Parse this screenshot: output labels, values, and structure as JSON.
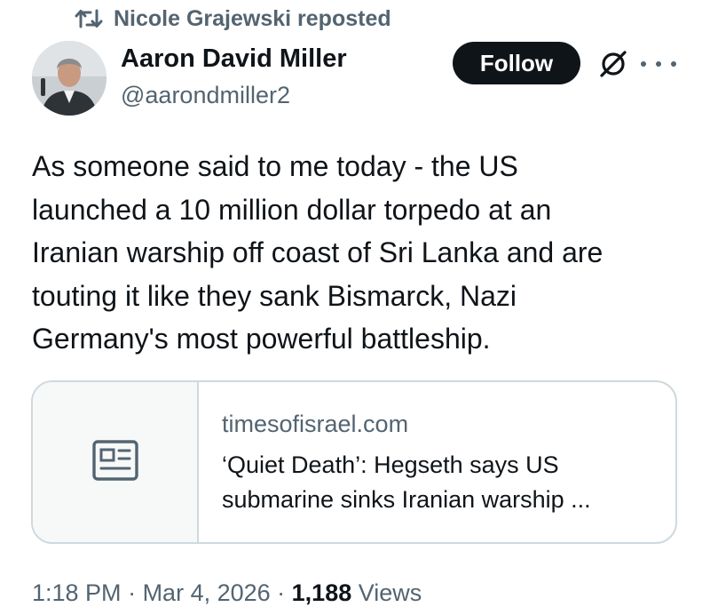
{
  "repost": {
    "icon": "repost-icon",
    "text": "Nicole Grajewski reposted"
  },
  "author": {
    "name": "Aaron David Miller",
    "handle": "@aarondmiller2",
    "avatar_icon": "avatar-photo"
  },
  "actions": {
    "follow_label": "Follow",
    "grok_icon": "grok-icon",
    "more_icon": "more-icon"
  },
  "tweet": {
    "text": "As someone said to me today - the US\nlaunched a 10 million dollar torpedo at an\nIranian warship  off coast of Sri Lanka and are\ntouting it like they sank Bismarck, Nazi\nGermany's most powerful battleship."
  },
  "link_card": {
    "icon": "article-icon",
    "domain": "timesofisrael.com",
    "title": "‘Quiet Death’: Hegseth says US\nsubmarine sinks Iranian warship ..."
  },
  "meta": {
    "time": "1:18 PM",
    "separator1": " · ",
    "date": "Mar 4, 2026",
    "separator2": " · ",
    "views_count": "1,188",
    "views_label": " Views"
  },
  "colors": {
    "text_primary": "#0f1419",
    "text_secondary": "#536471",
    "border": "#cfd9de",
    "follow_bg": "#0f1419"
  }
}
